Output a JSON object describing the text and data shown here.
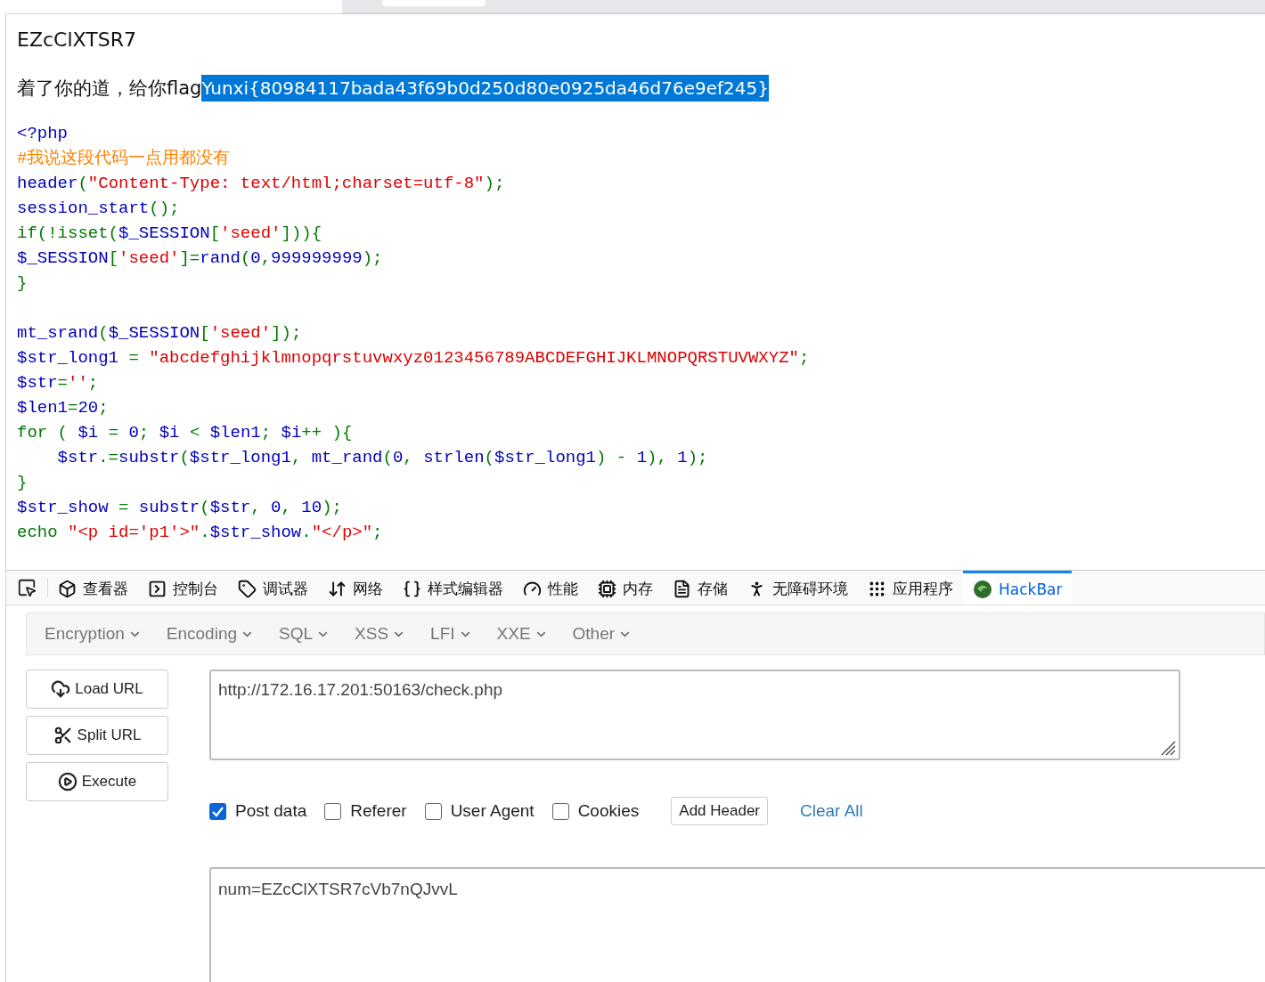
{
  "page": {
    "output": "EZcClXTSR7",
    "message": "着了你的道，给你flag",
    "selected_text": "Yunxi{80984117bada43f69b0d250d80e0925da46d76e9ef245}",
    "code": [
      [
        [
          {
            "kind": "default",
            "text": "<?php"
          }
        ],
        [
          {
            "kind": "comment",
            "text": "#我说这段代码一点用都没有"
          }
        ],
        [
          {
            "kind": "default",
            "text": "header"
          },
          {
            "kind": "keyword",
            "text": "("
          },
          {
            "kind": "string",
            "text": "\"Content-Type: text/html;charset=utf-8\""
          },
          {
            "kind": "keyword",
            "text": ");"
          }
        ],
        [
          {
            "kind": "default",
            "text": "session_start"
          },
          {
            "kind": "keyword",
            "text": "();"
          }
        ],
        [
          {
            "kind": "keyword",
            "text": "if(!isset("
          },
          {
            "kind": "default",
            "text": "$_SESSION"
          },
          {
            "kind": "keyword",
            "text": "["
          },
          {
            "kind": "string",
            "text": "'seed'"
          },
          {
            "kind": "keyword",
            "text": "])){"
          }
        ],
        [
          {
            "kind": "default",
            "text": "$_SESSION"
          },
          {
            "kind": "keyword",
            "text": "["
          },
          {
            "kind": "string",
            "text": "'seed'"
          },
          {
            "kind": "keyword",
            "text": "]="
          },
          {
            "kind": "default",
            "text": "rand"
          },
          {
            "kind": "keyword",
            "text": "("
          },
          {
            "kind": "default",
            "text": "0"
          },
          {
            "kind": "keyword",
            "text": ","
          },
          {
            "kind": "default",
            "text": "999999999"
          },
          {
            "kind": "keyword",
            "text": ");"
          }
        ],
        [
          {
            "kind": "keyword",
            "text": "}"
          }
        ]
      ],
      [
        [
          {
            "kind": "default",
            "text": "mt_srand"
          },
          {
            "kind": "keyword",
            "text": "("
          },
          {
            "kind": "default",
            "text": "$_SESSION"
          },
          {
            "kind": "keyword",
            "text": "["
          },
          {
            "kind": "string",
            "text": "'seed'"
          },
          {
            "kind": "keyword",
            "text": "]);"
          }
        ],
        [
          {
            "kind": "default",
            "text": "$str_long1 "
          },
          {
            "kind": "keyword",
            "text": "= "
          },
          {
            "kind": "string",
            "text": "\"abcdefghijklmnopqrstuvwxyz0123456789ABCDEFGHIJKLMNOPQRSTUVWXYZ\""
          },
          {
            "kind": "keyword",
            "text": ";"
          }
        ],
        [
          {
            "kind": "default",
            "text": "$str"
          },
          {
            "kind": "keyword",
            "text": "="
          },
          {
            "kind": "string",
            "text": "''"
          },
          {
            "kind": "keyword",
            "text": ";"
          }
        ],
        [
          {
            "kind": "default",
            "text": "$len1"
          },
          {
            "kind": "keyword",
            "text": "="
          },
          {
            "kind": "default",
            "text": "20"
          },
          {
            "kind": "keyword",
            "text": ";"
          }
        ],
        [
          {
            "kind": "keyword",
            "text": "for ( "
          },
          {
            "kind": "default",
            "text": "$i "
          },
          {
            "kind": "keyword",
            "text": "= "
          },
          {
            "kind": "default",
            "text": "0"
          },
          {
            "kind": "keyword",
            "text": "; "
          },
          {
            "kind": "default",
            "text": "$i "
          },
          {
            "kind": "keyword",
            "text": "< "
          },
          {
            "kind": "default",
            "text": "$len1"
          },
          {
            "kind": "keyword",
            "text": "; "
          },
          {
            "kind": "default",
            "text": "$i"
          },
          {
            "kind": "keyword",
            "text": "++ ){"
          }
        ],
        [
          {
            "kind": "default",
            "text": "    $str"
          },
          {
            "kind": "keyword",
            "text": ".="
          },
          {
            "kind": "default",
            "text": "substr"
          },
          {
            "kind": "keyword",
            "text": "("
          },
          {
            "kind": "default",
            "text": "$str_long1"
          },
          {
            "kind": "keyword",
            "text": ", "
          },
          {
            "kind": "default",
            "text": "mt_rand"
          },
          {
            "kind": "keyword",
            "text": "("
          },
          {
            "kind": "default",
            "text": "0"
          },
          {
            "kind": "keyword",
            "text": ", "
          },
          {
            "kind": "default",
            "text": "strlen"
          },
          {
            "kind": "keyword",
            "text": "("
          },
          {
            "kind": "default",
            "text": "$str_long1"
          },
          {
            "kind": "keyword",
            "text": ") - "
          },
          {
            "kind": "default",
            "text": "1"
          },
          {
            "kind": "keyword",
            "text": "), "
          },
          {
            "kind": "default",
            "text": "1"
          },
          {
            "kind": "keyword",
            "text": ");"
          }
        ],
        [
          {
            "kind": "keyword",
            "text": "}"
          }
        ],
        [
          {
            "kind": "default",
            "text": "$str_show "
          },
          {
            "kind": "keyword",
            "text": "= "
          },
          {
            "kind": "default",
            "text": "substr"
          },
          {
            "kind": "keyword",
            "text": "("
          },
          {
            "kind": "default",
            "text": "$str"
          },
          {
            "kind": "keyword",
            "text": ", "
          },
          {
            "kind": "default",
            "text": "0"
          },
          {
            "kind": "keyword",
            "text": ", "
          },
          {
            "kind": "default",
            "text": "10"
          },
          {
            "kind": "keyword",
            "text": ");"
          }
        ],
        [
          {
            "kind": "keyword",
            "text": "echo "
          },
          {
            "kind": "string",
            "text": "\"<p id='p1'>\""
          },
          {
            "kind": "keyword",
            "text": "."
          },
          {
            "kind": "default",
            "text": "$str_show"
          },
          {
            "kind": "keyword",
            "text": "."
          },
          {
            "kind": "string",
            "text": "\"</p>\""
          },
          {
            "kind": "keyword",
            "text": ";"
          }
        ]
      ]
    ]
  },
  "devtools": {
    "tabs": [
      {
        "kind": "inspector",
        "label": "查看器",
        "selected": false
      },
      {
        "kind": "console",
        "label": "控制台",
        "selected": false
      },
      {
        "kind": "debugger",
        "label": "调试器",
        "selected": false
      },
      {
        "kind": "network",
        "label": "网络",
        "selected": false
      },
      {
        "kind": "style",
        "label": "样式编辑器",
        "selected": false
      },
      {
        "kind": "performance",
        "label": "性能",
        "selected": false
      },
      {
        "kind": "memory",
        "label": "内存",
        "selected": false
      },
      {
        "kind": "storage",
        "label": "存储",
        "selected": false
      },
      {
        "kind": "accessibility",
        "label": "无障碍环境",
        "selected": false
      },
      {
        "kind": "application",
        "label": "应用程序",
        "selected": false
      },
      {
        "kind": "hackbar",
        "label": "HackBar",
        "selected": true
      }
    ]
  },
  "hackbar": {
    "menu": [
      "Encryption",
      "Encoding",
      "SQL",
      "XSS",
      "LFI",
      "XXE",
      "Other"
    ],
    "buttons": [
      {
        "kind": "load",
        "label": "Load URL"
      },
      {
        "kind": "split",
        "label": "Split URL"
      },
      {
        "kind": "execute",
        "label": "Execute"
      }
    ],
    "url": "http://172.16.17.201:50163/check.php",
    "options": [
      {
        "label": "Post data",
        "checked": true
      },
      {
        "label": "Referer",
        "checked": false
      },
      {
        "label": "User Agent",
        "checked": false
      },
      {
        "label": "Cookies",
        "checked": false
      }
    ],
    "add_header": "Add Header",
    "clear_all": "Clear All",
    "post_body": "num=EZcClXTSR7cVb7nQJvvL"
  }
}
